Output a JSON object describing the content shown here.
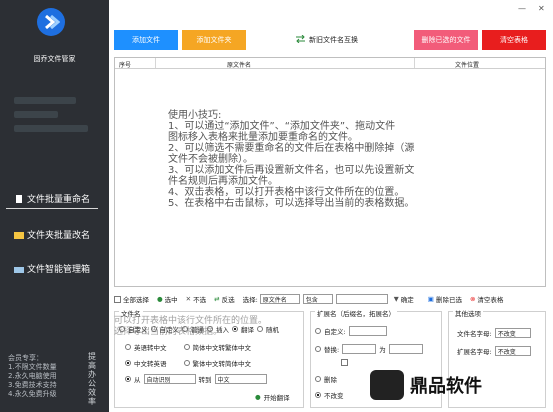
{
  "app": {
    "title": "固乔文件管家"
  },
  "sidebar": {
    "items": [
      {
        "label": "文件批量重命名",
        "icon": "document-icon",
        "active": true
      },
      {
        "label": "文件夹批量改名",
        "icon": "folder-icon",
        "active": false
      },
      {
        "label": "文件智能管理箱",
        "icon": "toolbox-icon",
        "active": false
      }
    ],
    "member": {
      "title": "会员专享：",
      "lines": [
        "1.不限文件数量",
        "2.永久电脑使用",
        "3.免费技术支持",
        "4.永久免费升级"
      ]
    },
    "vertical_text": "提高办公效率"
  },
  "window": {
    "min": "—",
    "close": "✕"
  },
  "toolbar": {
    "add_file": "添加文件",
    "add_folder": "添加文件夹",
    "rename": "新旧文件名互换",
    "delete_selected": "删除已选的文件",
    "clear_table": "清空表格"
  },
  "colors": {
    "blue": "#1e90ff",
    "orange": "#f5a623",
    "pink": "#f25c7a",
    "red": "#e81e1e",
    "sidebar": "#2c2f34"
  },
  "table": {
    "headers": [
      "序号",
      "原文件名",
      "文件位置"
    ],
    "tips": [
      "使用小技巧:",
      "1、可以通过“添加文件”、“添加文件夹”、拖动文件",
      "图标移入表格来批量添加要重命名的文件。",
      "2、可以筛选不需要重命名的文件后在表格中删除掉（源",
      "文件不会被删除）。",
      "3、可以添加文件后再设置新文件名，也可以先设置新文",
      "件名规则后再添加文件。",
      "4、双击表格，可以打开表格中该行文件所在的位置。",
      "5、在表格中右击鼠标，可以选择导出当前的表格数据。"
    ]
  },
  "filter": {
    "select_all": "全部选择",
    "select": "选中",
    "deselect": "不选",
    "invert": "反选",
    "choose_label": "选择:",
    "field": "原文件名",
    "op": "包含",
    "confirm": "确定",
    "delete_selected": "删除已选",
    "clear_table": "清空表格"
  },
  "overlay": [
    "可以打开表格中该行文件所在的位置。",
    "选择导出当前的表格数据。"
  ],
  "panel_filename": {
    "legend": "文件名",
    "row1": [
      "自定义",
      "自定义",
      "普通",
      "插入",
      "翻译",
      "随机"
    ],
    "row2": [
      "英语转中文",
      "简体中文转繁体中文"
    ],
    "row3": [
      "中文转英语",
      "繁体中文转简体中文"
    ],
    "from_label": "从",
    "from_value": "自动识别",
    "to_label": "转到",
    "to_value": "中文",
    "start": "开始翻译"
  },
  "panel_ext": {
    "legend": "扩展名（后缀名，拓展名）",
    "custom": "自定义:",
    "replace": "替换:",
    "for": "为",
    "remove": "删除",
    "no_change": "不改变"
  },
  "panel_other": {
    "legend": "其他选项",
    "filename_case_label": "文件名字母:",
    "filename_case_value": "不改变",
    "ext_case_label": "扩展名字母:",
    "ext_case_value": "不改变"
  },
  "watermark": "鼎品软件"
}
